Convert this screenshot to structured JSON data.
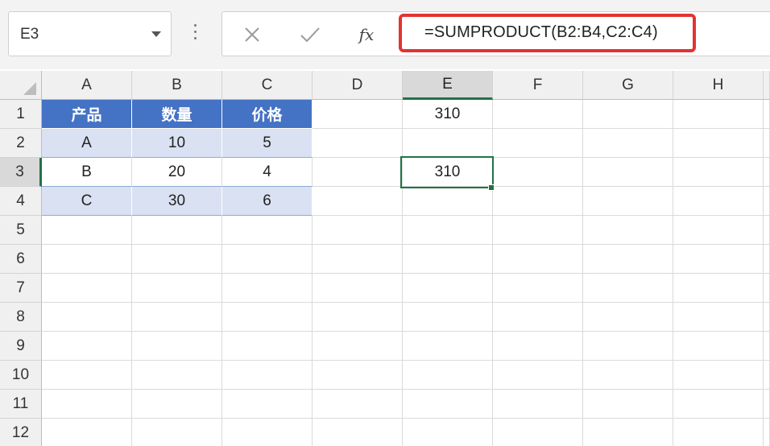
{
  "name_box": {
    "value": "E3"
  },
  "formula_bar": {
    "fx_label": "fx",
    "formula": "=SUMPRODUCT(B2:B4,C2:C4)",
    "highlight_color": "#e23333"
  },
  "icons": {
    "cancel": "close-icon",
    "enter": "checkmark-icon",
    "insert_function": "fx-icon",
    "name_box_dropdown": "chevron-down-icon",
    "more": "vertical-dots-icon"
  },
  "columns": [
    "A",
    "B",
    "C",
    "D",
    "E",
    "F",
    "G",
    "H"
  ],
  "rows": [
    "1",
    "2",
    "3",
    "4",
    "5",
    "6",
    "7",
    "8",
    "9",
    "10",
    "11",
    "12"
  ],
  "selection": {
    "cell": "E3",
    "column": "E",
    "row": "3",
    "accent": "#217346"
  },
  "table": {
    "header_color": "#4472c4",
    "band_color": "#d9e1f2",
    "headers": [
      "产品",
      "数量",
      "价格"
    ],
    "rows": [
      [
        "A",
        "10",
        "5"
      ],
      [
        "B",
        "20",
        "4"
      ],
      [
        "C",
        "30",
        "6"
      ]
    ]
  },
  "results": {
    "E1": "310",
    "E3": "310"
  }
}
